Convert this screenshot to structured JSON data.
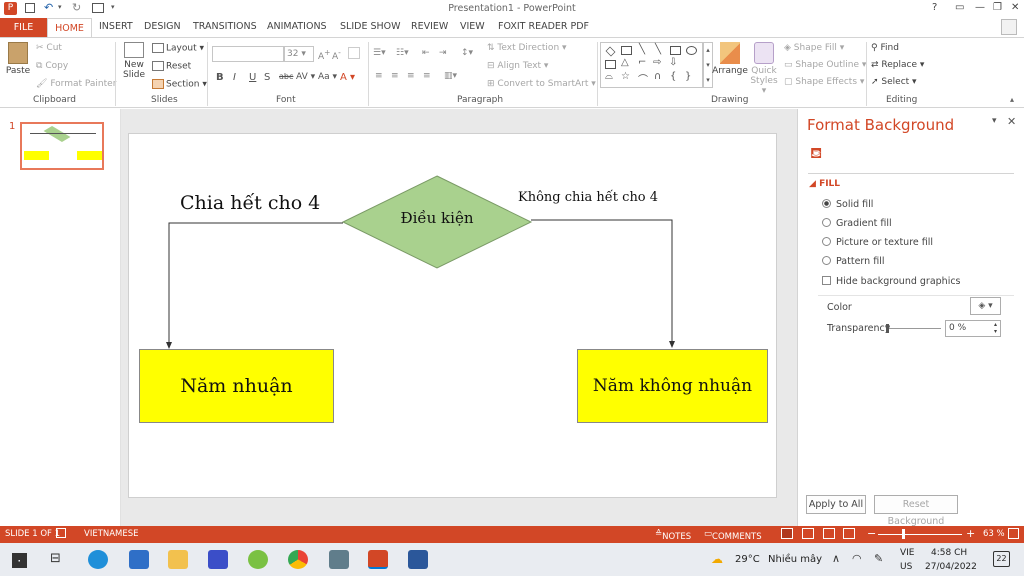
{
  "window": {
    "title": "Presentation1 - PowerPoint",
    "help": "?"
  },
  "tabs": [
    "FILE",
    "HOME",
    "INSERT",
    "DESIGN",
    "TRANSITIONS",
    "ANIMATIONS",
    "SLIDE SHOW",
    "REVIEW",
    "VIEW",
    "FOXIT READER PDF"
  ],
  "ribbon": {
    "clipboard": {
      "paste": "Paste",
      "cut": "Cut",
      "copy": "Copy",
      "format_painter": "Format Painter",
      "label": "Clipboard"
    },
    "slides": {
      "new_slide_1": "New",
      "new_slide_2": "Slide",
      "layout": "Layout",
      "reset": "Reset",
      "section": "Section",
      "label": "Slides"
    },
    "font": {
      "size": "32",
      "label": "Font"
    },
    "paragraph": {
      "text_direction": "Text Direction",
      "align_text": "Align Text",
      "convert": "Convert to SmartArt",
      "label": "Paragraph"
    },
    "drawing": {
      "arrange": "Arrange",
      "quick_styles_1": "Quick",
      "quick_styles_2": "Styles",
      "shape_fill": "Shape Fill",
      "shape_outline": "Shape Outline",
      "shape_effects": "Shape Effects",
      "label": "Drawing"
    },
    "editing": {
      "find": "Find",
      "replace": "Replace",
      "select": "Select",
      "label": "Editing"
    }
  },
  "thumbnail": {
    "number": "1"
  },
  "slide": {
    "left_label": "Chia hết cho 4",
    "right_label": "Không chia hết cho 4",
    "diamond": "Điều kiện",
    "box_left": "Năm nhuận",
    "box_right": "Năm không nhuận"
  },
  "pane": {
    "title": "Format Background",
    "section": "FILL",
    "solid": "Solid fill",
    "gradient": "Gradient fill",
    "picture": "Picture or texture fill",
    "pattern": "Pattern fill",
    "hide": "Hide background graphics",
    "color": "Color",
    "transparency": "Transparency",
    "transparency_value": "0 %",
    "transparency_level": 0,
    "apply_all": "Apply to All",
    "reset": "Reset Background"
  },
  "status": {
    "slide": "SLIDE 1 OF 1",
    "language": "VIETNAMESE",
    "notes": "NOTES",
    "comments": "COMMENTS",
    "zoom": "63 %",
    "zoom_level": 0.63
  },
  "taskbar": {
    "weather": "29°C",
    "weather_text": "Nhiều mây",
    "lang_1": "VIE",
    "lang_2": "US",
    "time": "4:58 CH",
    "date": "27/04/2022",
    "notifications": "22"
  },
  "colors": {
    "accent": "#d24726",
    "diamond": "#a9d18e",
    "box": "#ffff00"
  }
}
